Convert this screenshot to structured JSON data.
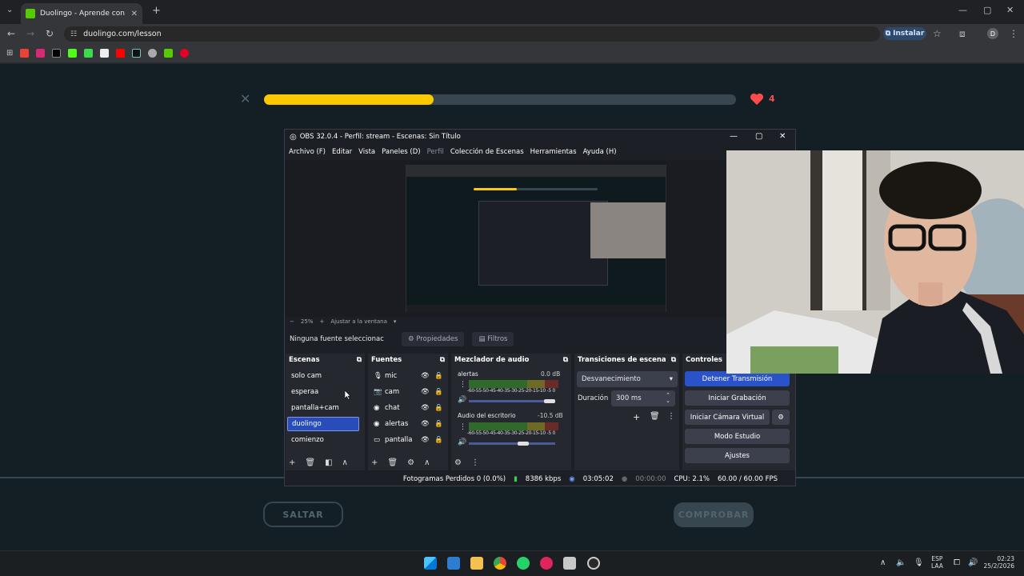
{
  "browser": {
    "tab_title": "Duolingo - Aprende con leccio",
    "url": "duolingo.com/lesson",
    "install_label": "Instalar",
    "profile_initial": "D"
  },
  "lesson": {
    "progress": 0.36,
    "hearts": "4",
    "skip_label": "SALTAR",
    "check_label": "COMPROBAR"
  },
  "obs": {
    "title": "OBS 32.0.4 - Perfil: stream - Escenas: Sin Título",
    "menu": [
      "Archivo (F)",
      "Editar",
      "Vista",
      "Paneles (D)",
      "Perfil",
      "Colección de Escenas",
      "Herramientas",
      "Ayuda (H)"
    ],
    "zoom": {
      "minus": "−",
      "percent": "25%",
      "plus": "+",
      "fit": "Ajustar a la ventana"
    },
    "no_source": "Ninguna fuente seleccionac",
    "properties_label": "Propiedades",
    "filters_label": "Filtros",
    "scenes": {
      "header": "Escenas",
      "items": [
        "solo cam",
        "esperaa",
        "pantalla+cam",
        "duolingo",
        "comienzo"
      ],
      "selected": "duolingo"
    },
    "sources": {
      "header": "Fuentes",
      "items": [
        "mic",
        "cam",
        "chat",
        "alertas",
        "pantalla"
      ]
    },
    "mixer": {
      "header": "Mezclador de audio",
      "channels": [
        {
          "name": "alertas",
          "db": "0.0 dB",
          "volume": 1.0
        },
        {
          "name": "Audio del escritorio",
          "db": "-10.5 dB",
          "volume": 0.65
        }
      ],
      "scale": "-60-55-50-45-40-35-30-25-20-15-10 -5 0"
    },
    "transitions": {
      "header": "Transiciones de escena",
      "selected": "Desvanecimiento",
      "duration_label": "Duración",
      "duration_value": "300 ms"
    },
    "controls": {
      "header": "Controles",
      "stop_stream": "Detener Transmisión",
      "start_record": "Iniciar Grabación",
      "start_virtual_cam": "Iniciar Cámara Virtual",
      "studio_mode": "Modo Estudio",
      "settings": "Ajustes"
    },
    "status": {
      "dropped_frames": "Fotogramas Perdidos 0 (0.0%)",
      "bitrate": "8386 kbps",
      "stream_time": "03:05:02",
      "record_time": "00:00:00",
      "cpu": "CPU: 2.1%",
      "fps": "60.00 / 60.00 FPS"
    }
  },
  "taskbar": {
    "lang": "ESP",
    "lang_sub": "LAA",
    "time": "02:23",
    "date": "25/2/2026"
  },
  "colors": {
    "duolingo_bg": "#131f24",
    "progress_yellow": "#fcc800",
    "heart_red": "#ff4b4b",
    "obs_selected": "#284cb8",
    "stream_btn": "#2a52c9"
  }
}
